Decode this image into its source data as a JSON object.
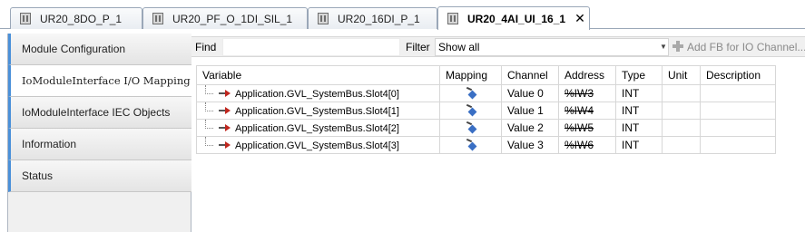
{
  "tabs": [
    {
      "label": "UR20_8DO_P_1",
      "active": false
    },
    {
      "label": "UR20_PF_O_1DI_SIL_1",
      "active": false
    },
    {
      "label": "UR20_16DI_P_1",
      "active": false
    },
    {
      "label": "UR20_4AI_UI_16_1",
      "active": true
    }
  ],
  "nav": {
    "items": [
      {
        "label": "Module Configuration"
      },
      {
        "label": "IoModuleInterface I/O Mapping"
      },
      {
        "label": "IoModuleInterface IEC Objects"
      },
      {
        "label": "Information"
      },
      {
        "label": "Status"
      }
    ]
  },
  "toolbar": {
    "find_label": "Find",
    "find_value": "",
    "filter_label": "Filter",
    "filter_value": "Show all",
    "add_fb_label": "Add FB for IO Channel..."
  },
  "table": {
    "headers": {
      "variable": "Variable",
      "mapping": "Mapping",
      "channel": "Channel",
      "address": "Address",
      "type": "Type",
      "unit": "Unit",
      "description": "Description"
    },
    "rows": [
      {
        "variable": "Application.GVL_SystemBus.Slot4[0]",
        "channel": "Value 0",
        "address": "%IW3",
        "type": "INT",
        "unit": "",
        "description": ""
      },
      {
        "variable": "Application.GVL_SystemBus.Slot4[1]",
        "channel": "Value 1",
        "address": "%IW4",
        "type": "INT",
        "unit": "",
        "description": ""
      },
      {
        "variable": "Application.GVL_SystemBus.Slot4[2]",
        "channel": "Value 2",
        "address": "%IW5",
        "type": "INT",
        "unit": "",
        "description": ""
      },
      {
        "variable": "Application.GVL_SystemBus.Slot4[3]",
        "channel": "Value 3",
        "address": "%IW6",
        "type": "INT",
        "unit": "",
        "description": ""
      }
    ]
  },
  "icons": {
    "tab_icon": "device-module-icon",
    "close_icon": "close-icon",
    "variable_icon": "input-variable-arrow-icon",
    "mapping_icon": "existing-variable-mapping-icon",
    "add_icon": "plus-icon",
    "dropdown_icon": "chevron-down-icon"
  },
  "colors": {
    "nav_accent": "#4a90d9",
    "variable_arrow": "#c0261e",
    "mapping_icon": "#3a6fc4",
    "disabled_text": "#8a8a8a"
  }
}
